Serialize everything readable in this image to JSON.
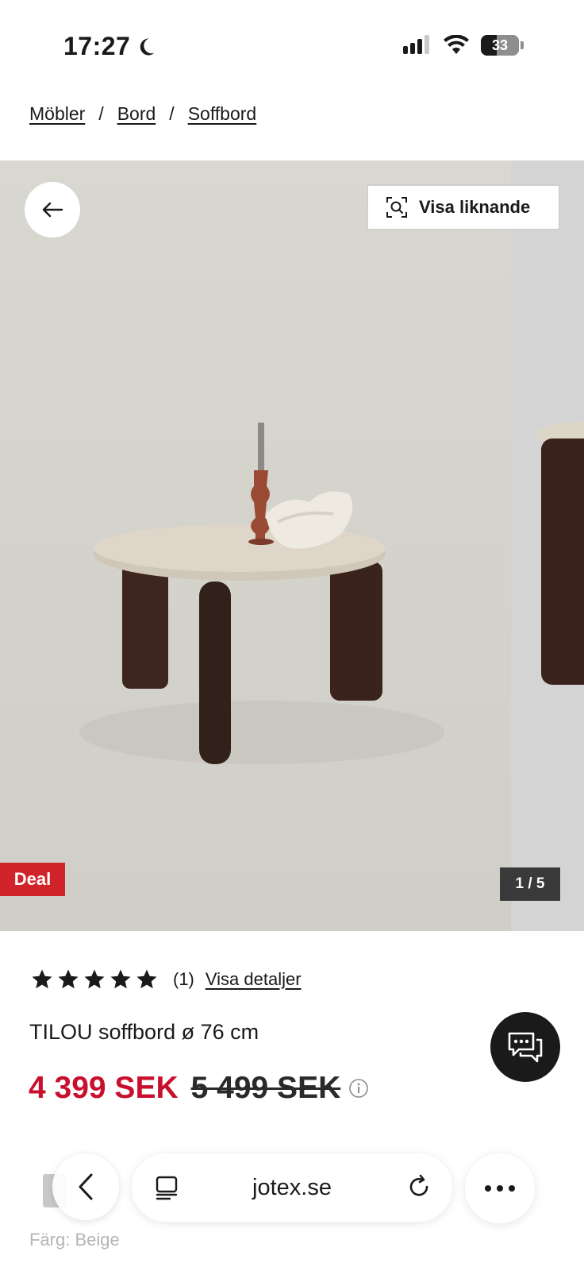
{
  "status_bar": {
    "time": "17:27",
    "battery": "33"
  },
  "breadcrumb": {
    "items": [
      "Möbler",
      "Bord",
      "Soffbord"
    ],
    "separator": "/"
  },
  "gallery": {
    "similar_button": "Visa liknande",
    "deal_badge": "Deal",
    "counter": "1 / 5"
  },
  "product": {
    "rating_stars": 5,
    "rating_count": "(1)",
    "details_link": "Visa detaljer",
    "title": "TILOU soffbord ø 76 cm",
    "price_now": "4 399 SEK",
    "price_old": "5 499 SEK",
    "color_label": "Färg: Beige"
  },
  "browser": {
    "url": "jotex.se"
  },
  "colors": {
    "sale_red": "#c8102e",
    "deal_red": "#d1232a",
    "text": "#1a1a1a"
  }
}
